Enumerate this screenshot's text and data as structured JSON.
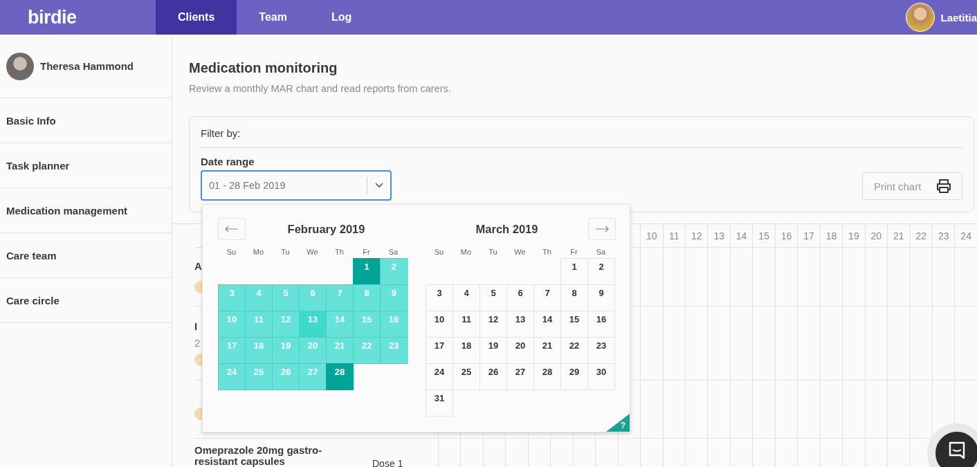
{
  "topbar": {
    "logo": "birdie",
    "tabs": [
      {
        "label": "Clients",
        "selected": true
      },
      {
        "label": "Team",
        "selected": false
      },
      {
        "label": "Log",
        "selected": false
      }
    ],
    "user": {
      "name": "Laetitia"
    }
  },
  "sidebar": {
    "client": {
      "name": "Theresa Hammond"
    },
    "items": [
      "Basic Info",
      "Task planner",
      "Medication management",
      "Care team",
      "Care circle"
    ]
  },
  "page": {
    "title": "Medication monitoring",
    "subtitle": "Review a monthly MAR chart and read reports from carers."
  },
  "filter": {
    "heading": "Filter by:",
    "date_range": {
      "label": "Date range",
      "value": "01 - 28 Feb 2019"
    },
    "print_button": "Print chart"
  },
  "calendar": {
    "months": [
      {
        "title": "February 2019",
        "weekdays": [
          "Su",
          "Mo",
          "Tu",
          "We",
          "Th",
          "Fr",
          "Sa"
        ],
        "weeks": [
          {
            "days": [
              {
                "d": "1",
                "in_range": true,
                "selected": true,
                "hovered": false
              },
              {
                "d": "2",
                "in_range": true,
                "selected": false,
                "hovered": false
              }
            ]
          },
          {
            "days": [
              {
                "d": "3",
                "in_range": true,
                "selected": false,
                "hovered": false
              },
              {
                "d": "4",
                "in_range": true,
                "selected": false,
                "hovered": false
              },
              {
                "d": "5",
                "in_range": true,
                "selected": false,
                "hovered": false
              },
              {
                "d": "6",
                "in_range": true,
                "selected": false,
                "hovered": false
              },
              {
                "d": "7",
                "in_range": true,
                "selected": false,
                "hovered": false
              },
              {
                "d": "8",
                "in_range": true,
                "selected": false,
                "hovered": false
              },
              {
                "d": "9",
                "in_range": true,
                "selected": false,
                "hovered": false
              }
            ]
          },
          {
            "days": [
              {
                "d": "10",
                "in_range": true,
                "selected": false,
                "hovered": false
              },
              {
                "d": "11",
                "in_range": true,
                "selected": false,
                "hovered": false
              },
              {
                "d": "12",
                "in_range": true,
                "selected": false,
                "hovered": false
              },
              {
                "d": "13",
                "in_range": true,
                "selected": false,
                "hovered": true
              },
              {
                "d": "14",
                "in_range": true,
                "selected": false,
                "hovered": false
              },
              {
                "d": "15",
                "in_range": true,
                "selected": false,
                "hovered": false
              },
              {
                "d": "16",
                "in_range": true,
                "selected": false,
                "hovered": false
              }
            ]
          },
          {
            "days": [
              {
                "d": "17",
                "in_range": true,
                "selected": false,
                "hovered": false
              },
              {
                "d": "18",
                "in_range": true,
                "selected": false,
                "hovered": false
              },
              {
                "d": "19",
                "in_range": true,
                "selected": false,
                "hovered": false
              },
              {
                "d": "20",
                "in_range": true,
                "selected": false,
                "hovered": false
              },
              {
                "d": "21",
                "in_range": true,
                "selected": false,
                "hovered": false
              },
              {
                "d": "22",
                "in_range": true,
                "selected": false,
                "hovered": false
              },
              {
                "d": "23",
                "in_range": true,
                "selected": false,
                "hovered": false
              }
            ]
          },
          {
            "days": [
              {
                "d": "24",
                "in_range": true,
                "selected": false,
                "hovered": false
              },
              {
                "d": "25",
                "in_range": true,
                "selected": false,
                "hovered": false
              },
              {
                "d": "26",
                "in_range": true,
                "selected": false,
                "hovered": false
              },
              {
                "d": "27",
                "in_range": true,
                "selected": false,
                "hovered": false
              },
              {
                "d": "28",
                "in_range": true,
                "selected": true,
                "hovered": false
              }
            ]
          }
        ]
      },
      {
        "title": "March 2019",
        "weekdays": [
          "Su",
          "Mo",
          "Tu",
          "We",
          "Th",
          "Fr",
          "Sa"
        ],
        "weeks": [
          {
            "days": [
              {
                "d": "1",
                "in_range": false,
                "selected": false,
                "hovered": false
              },
              {
                "d": "2",
                "in_range": false,
                "selected": false,
                "hovered": false
              }
            ]
          },
          {
            "days": [
              {
                "d": "3",
                "in_range": false,
                "selected": false,
                "hovered": false
              },
              {
                "d": "4",
                "in_range": false,
                "selected": false,
                "hovered": false
              },
              {
                "d": "5",
                "in_range": false,
                "selected": false,
                "hovered": false
              },
              {
                "d": "6",
                "in_range": false,
                "selected": false,
                "hovered": false
              },
              {
                "d": "7",
                "in_range": false,
                "selected": false,
                "hovered": false
              },
              {
                "d": "8",
                "in_range": false,
                "selected": false,
                "hovered": false
              },
              {
                "d": "9",
                "in_range": false,
                "selected": false,
                "hovered": false
              }
            ]
          },
          {
            "days": [
              {
                "d": "10",
                "in_range": false,
                "selected": false,
                "hovered": false
              },
              {
                "d": "11",
                "in_range": false,
                "selected": false,
                "hovered": false
              },
              {
                "d": "12",
                "in_range": false,
                "selected": false,
                "hovered": false
              },
              {
                "d": "13",
                "in_range": false,
                "selected": false,
                "hovered": false
              },
              {
                "d": "14",
                "in_range": false,
                "selected": false,
                "hovered": false
              },
              {
                "d": "15",
                "in_range": false,
                "selected": false,
                "hovered": false
              },
              {
                "d": "16",
                "in_range": false,
                "selected": false,
                "hovered": false
              }
            ]
          },
          {
            "days": [
              {
                "d": "17",
                "in_range": false,
                "selected": false,
                "hovered": false
              },
              {
                "d": "18",
                "in_range": false,
                "selected": false,
                "hovered": false
              },
              {
                "d": "19",
                "in_range": false,
                "selected": false,
                "hovered": false
              },
              {
                "d": "20",
                "in_range": false,
                "selected": false,
                "hovered": false
              },
              {
                "d": "21",
                "in_range": false,
                "selected": false,
                "hovered": false
              },
              {
                "d": "22",
                "in_range": false,
                "selected": false,
                "hovered": false
              },
              {
                "d": "23",
                "in_range": false,
                "selected": false,
                "hovered": false
              }
            ]
          },
          {
            "days": [
              {
                "d": "24",
                "in_range": false,
                "selected": false,
                "hovered": false
              },
              {
                "d": "25",
                "in_range": false,
                "selected": false,
                "hovered": false
              },
              {
                "d": "26",
                "in_range": false,
                "selected": false,
                "hovered": false
              },
              {
                "d": "27",
                "in_range": false,
                "selected": false,
                "hovered": false
              },
              {
                "d": "28",
                "in_range": false,
                "selected": false,
                "hovered": false
              },
              {
                "d": "29",
                "in_range": false,
                "selected": false,
                "hovered": false
              },
              {
                "d": "30",
                "in_range": false,
                "selected": false,
                "hovered": false
              }
            ]
          },
          {
            "days": [
              {
                "d": "31",
                "in_range": false,
                "selected": false,
                "hovered": false
              }
            ]
          }
        ]
      }
    ],
    "help": "?"
  },
  "table": {
    "days": [
      "10",
      "11",
      "12",
      "13",
      "14",
      "15",
      "16",
      "17",
      "18",
      "19",
      "20",
      "21",
      "22",
      "23",
      "24"
    ],
    "rows": [
      {
        "name": "A",
        "badge": true
      },
      {
        "name": "I",
        "detail": "2",
        "badge": true
      },
      {
        "badge": true
      },
      {
        "name": "Omeprazole 20mg gastro-resistant capsules",
        "dose": "Dose 1",
        "badge": false
      }
    ]
  }
}
